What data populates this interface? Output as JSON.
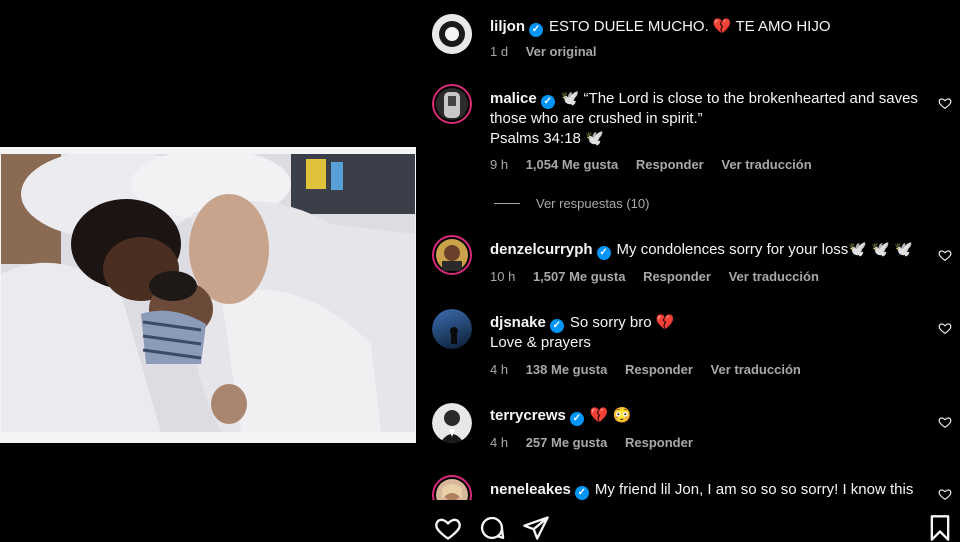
{
  "post": {
    "author": "liljon",
    "caption": "ESTO DUELE MUCHO. 💔  TE AMO HIJO",
    "time": "1 d",
    "see_original": "Ver original"
  },
  "replies_toggle": "Ver respuestas (10)",
  "comments": [
    {
      "user": "malice",
      "text_line1": "🕊️ “The Lord is close to the brokenhearted and saves",
      "text_line2": "those who are crushed in spirit.”",
      "text_line3": "Psalms 34:18 🕊️",
      "time": "9 h",
      "likes": "1,054 Me gusta",
      "reply": "Responder",
      "translate": "Ver traducción"
    },
    {
      "user": "denzelcurryph",
      "text_line1": "My condolences sorry for your loss🕊️ 🕊️ 🕊️",
      "time": "10 h",
      "likes": "1,507 Me gusta",
      "reply": "Responder",
      "translate": "Ver traducción"
    },
    {
      "user": "djsnake",
      "text_line1": "So sorry bro 💔",
      "text_line2": "Love & prayers",
      "time": "4 h",
      "likes": "138 Me gusta",
      "reply": "Responder",
      "translate": "Ver traducción"
    },
    {
      "user": "terrycrews",
      "text_line1": "💔 😳",
      "time": "4 h",
      "likes": "257 Me gusta",
      "reply": "Responder"
    },
    {
      "user": "neneleakes",
      "text_line1": "My friend lil Jon, I am so so so sorry! I know this"
    }
  ],
  "icons": {
    "like": "heart-icon",
    "comment": "comment-icon",
    "share": "share-icon",
    "save": "bookmark-icon",
    "verified": "verified-badge-icon"
  },
  "colors": {
    "background": "#000000",
    "verified": "#0095f6",
    "story_ring": "#d62976",
    "muted_text": "#a8a8a8"
  }
}
